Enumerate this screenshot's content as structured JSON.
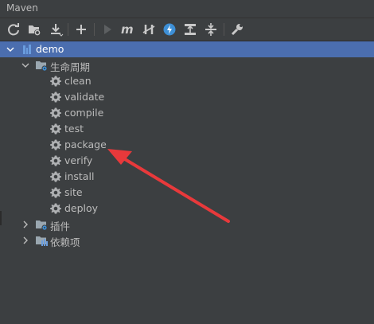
{
  "panel": {
    "title": "Maven"
  },
  "toolbar": {
    "buttons": [
      "reload-icon",
      "add-source-folder-icon",
      "download-icon",
      "add-icon",
      "run-icon",
      "maven-goal-icon",
      "skip-tests-icon",
      "offline-icon",
      "show-dependencies-icon",
      "collapse-icon",
      "settings-icon"
    ]
  },
  "tree": {
    "project": {
      "label": "demo",
      "expanded": true,
      "selected": true
    },
    "lifecycle": {
      "label": "生命周期",
      "expanded": true,
      "goals": [
        "clean",
        "validate",
        "compile",
        "test",
        "package",
        "verify",
        "install",
        "site",
        "deploy"
      ]
    },
    "plugins": {
      "label": "插件",
      "expanded": false
    },
    "dependencies": {
      "label": "依赖项",
      "expanded": false
    }
  },
  "colors": {
    "background": "#3c3f41",
    "selection": "#4b6eaf",
    "text": "#bbbbbb",
    "annotation_arrow": "#e8393b"
  }
}
